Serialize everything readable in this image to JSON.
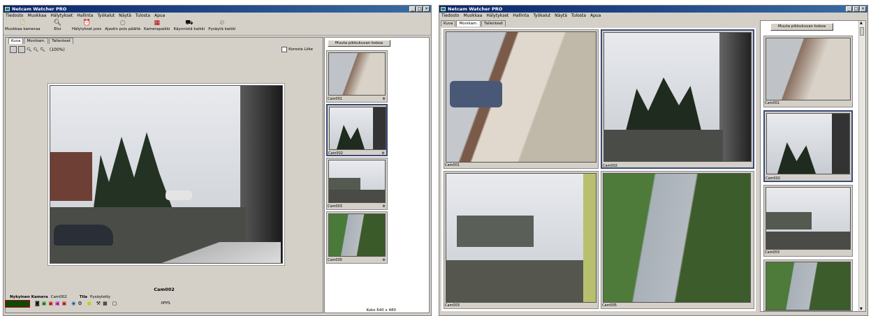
{
  "left": {
    "title": "Netcam Watcher PRO",
    "window_buttons": [
      "_",
      "□",
      "×"
    ],
    "menu": [
      "Tiedosto",
      "Muokkaa",
      "Hälytykset",
      "Hallinta",
      "Työkalut",
      "Näytä",
      "Tulosta",
      "Apua"
    ],
    "toolbar": [
      {
        "label": "Muokkaa kameraa",
        "icon": "page-icon"
      },
      {
        "label": "Etsi",
        "icon": "magnifier-icon"
      },
      {
        "label": "Hälytykset pois",
        "icon": "alarm-icon"
      },
      {
        "label": "Ajastin pois päältä",
        "icon": "timer-icon"
      },
      {
        "label": "Kamerapaikki",
        "icon": "camera-icon"
      },
      {
        "label": "Käynnistä kaikki",
        "icon": "start-all-icon"
      },
      {
        "label": "Pysäytä kaikki",
        "icon": "stop-all-icon"
      }
    ],
    "tabs": [
      "Kuva",
      "Monikam.",
      "Tallenteet"
    ],
    "zoom_text": "(100%)",
    "checkbox_label": "Korosta Liike",
    "main_caption": "Cam002",
    "resize_button": "Muuta pikkukuvan kokoa",
    "thumbs": [
      "Cam001",
      "Cam002",
      "Cam003",
      "Cam005"
    ],
    "status_current_label": "Nykyinen Kamera",
    "status_current_value": "Cam002",
    "status_state_label": "Tila",
    "status_state_value": "Pysäytetty",
    "fps": "0FPS",
    "size_text": "Koko 640 x 480"
  },
  "right": {
    "title": "Netcam Watcher PRO",
    "window_buttons": [
      "_",
      "□",
      "×"
    ],
    "menu": [
      "Tiedosto",
      "Muokkaa",
      "Hälytykset",
      "Hallinta",
      "Työkalut",
      "Näytä",
      "Tulosta",
      "Apua"
    ],
    "tabs": [
      "Kuva",
      "Monikam.",
      "Tallenteet"
    ],
    "grid": [
      "Cam001",
      "Cam002",
      "Cam003",
      "Cam005"
    ],
    "resize_button": "Muuta pikkukuvan kokoa",
    "thumbs": [
      "Cam001",
      "Cam002",
      "Cam003"
    ]
  }
}
